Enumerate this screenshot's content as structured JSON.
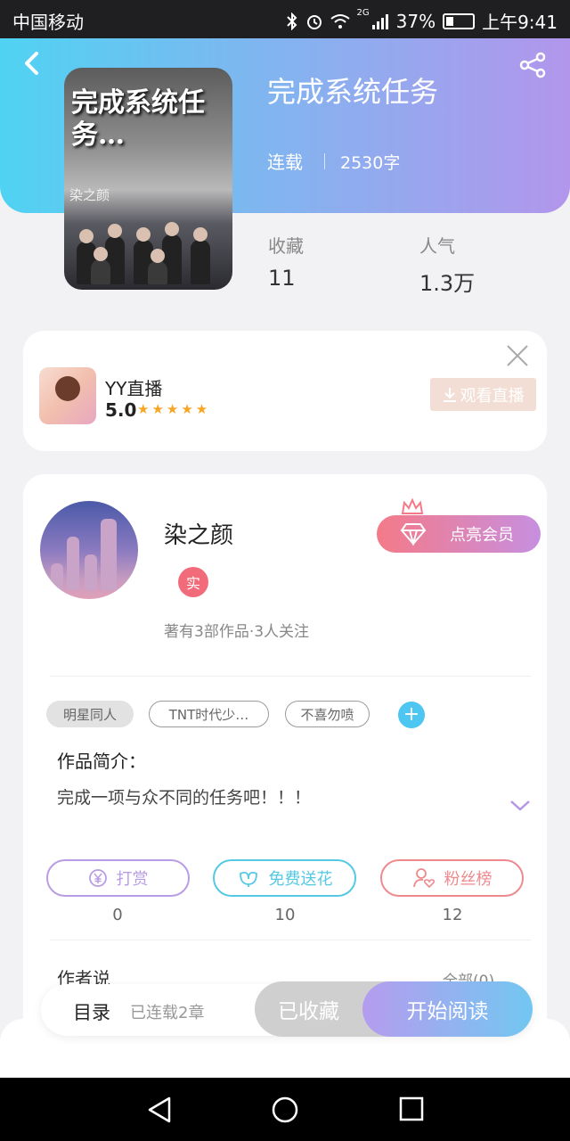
{
  "status_bar": {
    "carrier": "中国移动",
    "signal_tag": "2G",
    "battery": "37%",
    "time": "上午9:41"
  },
  "book": {
    "cover_title": "完成系统任务…",
    "cover_author": "染之颜",
    "title": "完成系统任务",
    "status": "连载",
    "word_count": "2530字"
  },
  "stats": [
    {
      "label": "收藏",
      "value": "11"
    },
    {
      "label": "人气",
      "value": "1.3万"
    }
  ],
  "ad": {
    "name": "YY直播",
    "rating": "5.0",
    "stars": "★★★★★",
    "button": "观看直播"
  },
  "author": {
    "name": "染之颜",
    "badge": "实",
    "meta": "著有3部作品·3人关注",
    "vip_button": "点亮会员"
  },
  "tags": [
    "明星同人",
    "TNT时代少…",
    "不喜勿喷"
  ],
  "intro": {
    "label": "作品简介：",
    "text": "完成一项与众不同的任务吧！！！"
  },
  "actions": [
    {
      "label": "打赏",
      "count": "0",
      "color": "#b99de4"
    },
    {
      "label": "免费送花",
      "count": "10",
      "color": "#55c9e4"
    },
    {
      "label": "粉丝榜",
      "count": "12",
      "color": "#ee8a8e"
    }
  ],
  "author_says": {
    "label": "作者说",
    "all": "全部(0)"
  },
  "bottom_bar": {
    "toc": "目录",
    "serial": "已连载2章",
    "collected": "已收藏",
    "read": "开始阅读"
  }
}
